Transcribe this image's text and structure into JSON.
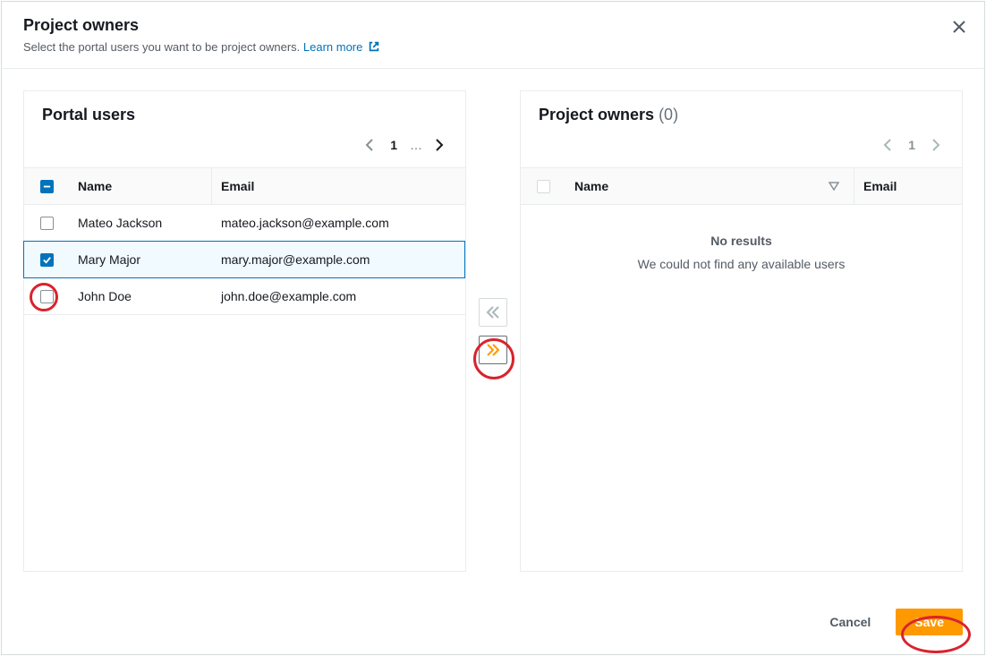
{
  "header": {
    "title": "Project owners",
    "subtitle_prefix": "Select the portal users you want to be project owners. ",
    "learn_more": "Learn more"
  },
  "left_panel": {
    "title": "Portal users",
    "page_num": "1",
    "columns": {
      "name": "Name",
      "email": "Email"
    },
    "rows": [
      {
        "name": "Mateo Jackson",
        "email": "mateo.jackson@example.com",
        "checked": false
      },
      {
        "name": "Mary Major",
        "email": "mary.major@example.com",
        "checked": true
      },
      {
        "name": "John Doe",
        "email": "john.doe@example.com",
        "checked": false
      }
    ]
  },
  "right_panel": {
    "title": "Project owners",
    "count": "(0)",
    "page_num": "1",
    "columns": {
      "name": "Name",
      "email": "Email"
    },
    "empty_title": "No results",
    "empty_sub": "We could not find any available users"
  },
  "footer": {
    "cancel": "Cancel",
    "save": "Save"
  }
}
